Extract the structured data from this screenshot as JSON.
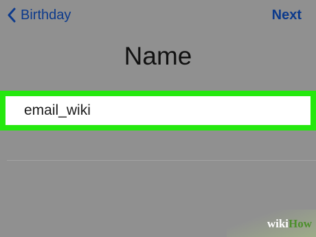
{
  "nav": {
    "back_label": "Birthday",
    "back_icon": "chevron-left-icon",
    "next_label": "Next"
  },
  "page": {
    "title": "Name"
  },
  "name_field": {
    "value": "email_wiki",
    "highlight_color": "#25e80e"
  },
  "watermark": {
    "wiki": "wiki",
    "how": "How"
  },
  "colors": {
    "background": "#909090",
    "nav_text": "#0c3a8c",
    "title_text": "#111111"
  }
}
